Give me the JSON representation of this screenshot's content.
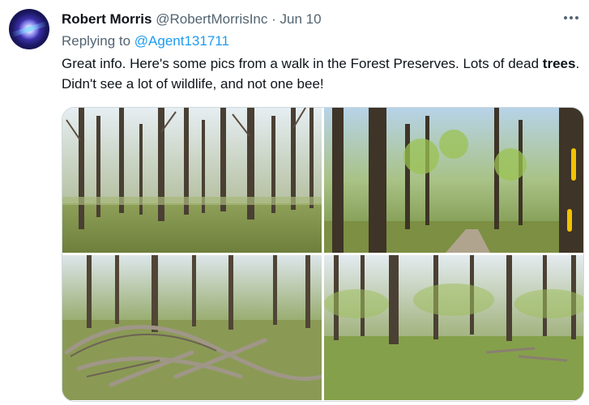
{
  "tweet": {
    "author_name": "Robert Morris",
    "author_handle": "@RobertMorrisInc",
    "separator": "·",
    "date": "Jun 10",
    "reply_prefix": "Replying to",
    "reply_handle": "@Agent131711",
    "text_part1": "Great info. Here's some pics from a walk in the Forest Preserves. Lots of dead",
    "text_bold": "trees",
    "text_part2": ". Didn't see a lot of wildlife, and not one bee!"
  },
  "icons": {
    "more": "more-horizontal-icon",
    "avatar": "avatar-image"
  },
  "colors": {
    "link": "#1d9bf0",
    "muted": "#536471",
    "text": "#0f1419",
    "border": "#cfd9de"
  }
}
